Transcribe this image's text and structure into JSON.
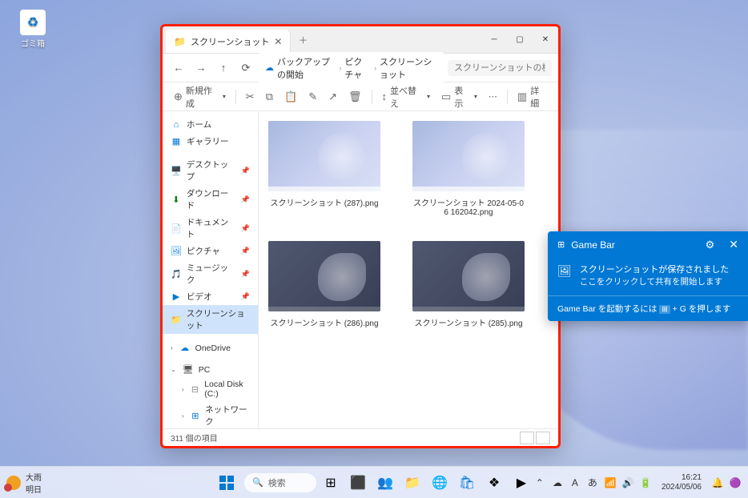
{
  "desktop": {
    "recycle_bin": "ゴミ箱"
  },
  "explorer": {
    "tab_title": "スクリーンショット",
    "breadcrumb": {
      "root": "バックアップの開始",
      "mid": "ピクチャ",
      "leaf": "スクリーンショット"
    },
    "search_placeholder": "スクリーンショットの検索",
    "toolbar": {
      "new": "新規作成",
      "sort": "並べ替え",
      "view": "表示",
      "details": "詳細"
    },
    "sidebar": {
      "home": "ホーム",
      "gallery": "ギャラリー",
      "pinned": [
        {
          "label": "デスクトップ",
          "icon": "🖥️",
          "color": "#0078d4"
        },
        {
          "label": "ダウンロード",
          "icon": "⬇",
          "color": "#107c10"
        },
        {
          "label": "ドキュメント",
          "icon": "📄",
          "color": "#0078d4"
        },
        {
          "label": "ピクチャ",
          "icon": "🖼",
          "color": "#0078d4"
        },
        {
          "label": "ミュージック",
          "icon": "🎵",
          "color": "#d83b01"
        },
        {
          "label": "ビデオ",
          "icon": "▶",
          "color": "#0078d4"
        },
        {
          "label": "スクリーンショット",
          "icon": "📁",
          "color": "#f7b500",
          "selected": true
        }
      ],
      "onedrive": "OneDrive",
      "pc": "PC",
      "localdisk": "Local Disk (C:)",
      "network": "ネットワーク"
    },
    "files": [
      {
        "name": "スクリーンショット (287).png",
        "dark": false
      },
      {
        "name": "スクリーンショット 2024-05-06 162042.png",
        "dark": false
      },
      {
        "name": "スクリーンショット (286).png",
        "dark": true
      },
      {
        "name": "スクリーンショット (285).png",
        "dark": true
      }
    ],
    "status": "311 個の項目"
  },
  "gamebar": {
    "title": "Game Bar",
    "msg1": "スクリーンショットが保存されました",
    "msg2": "ここをクリックして共有を開始します",
    "footer_prefix": "Game Bar を起動するには ",
    "footer_suffix": " + G を押します"
  },
  "taskbar": {
    "weather_line1": "大雨",
    "weather_line2": "明日",
    "search": "検索",
    "time": "16:21",
    "date": "2024/05/06"
  }
}
